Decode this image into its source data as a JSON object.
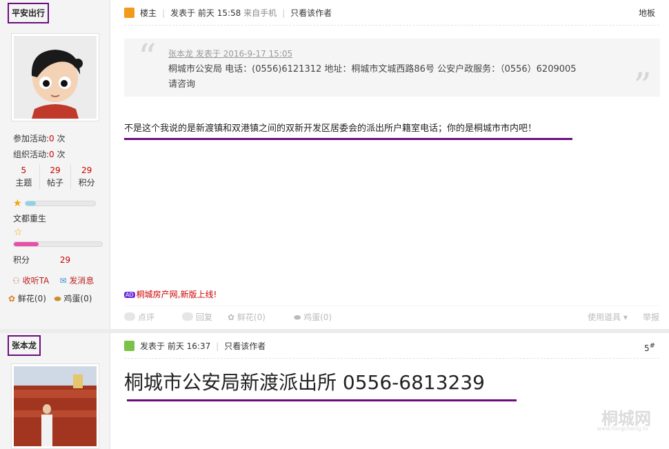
{
  "post1": {
    "user": {
      "name": "平安出行",
      "activity_join_label": "参加活动:",
      "activity_join_value": "0",
      "activity_org_label": "组织活动:",
      "activity_org_value": "0",
      "unit_ci": "次",
      "threads_value": "5",
      "threads_label": "主题",
      "posts_value": "29",
      "posts_label": "帖子",
      "points_value": "29",
      "points_label": "积分",
      "level_progress": 0.15,
      "rank_title": "文都重生",
      "rank_progress": 0.28,
      "points_row_label": "积分",
      "points_row_value": "29",
      "follow_label": "收听TA",
      "message_label": "发消息",
      "flower_label": "鲜花(0)",
      "egg_label": "鸡蛋(0)"
    },
    "meta": {
      "role": "楼主",
      "posted": "发表于  前天 15:58",
      "source": "来自手机",
      "only_author": "只看该作者",
      "floor": "地板"
    },
    "quote": {
      "author_line": "张本龙 发表于 2016-9-17 15:05",
      "text": "桐城市公安局 电话：(0556)6121312 地址：桐城市文城西路86号      公安户政服务：（0556）6209005请咨询"
    },
    "reply": "不是这个我说的是新渡镇和双港镇之间的双新开发区居委会的派出所户籍室电话；你的是桐城市市内吧！",
    "ad": {
      "icon": "AD",
      "text": "桐城房产网,新版上线!"
    },
    "footer": {
      "rate": "点评",
      "reply": "回复",
      "flower": "鲜花(0)",
      "egg": "鸡蛋(0)",
      "tools": "使用道具",
      "report": "举报"
    }
  },
  "post2": {
    "user": {
      "name": "张本龙"
    },
    "meta": {
      "posted": "发表于  前天 16:37",
      "only_author": "只看该作者",
      "floor": "5",
      "floor_sup": "#"
    },
    "content": "桐城市公安局新渡派出所 0556-6813239",
    "watermark": "桐城网",
    "watermark_sub": "www.tongcheng.tv"
  },
  "colors": {
    "accent_purple": "#6a0c7d",
    "number_red": "#cc0000"
  }
}
